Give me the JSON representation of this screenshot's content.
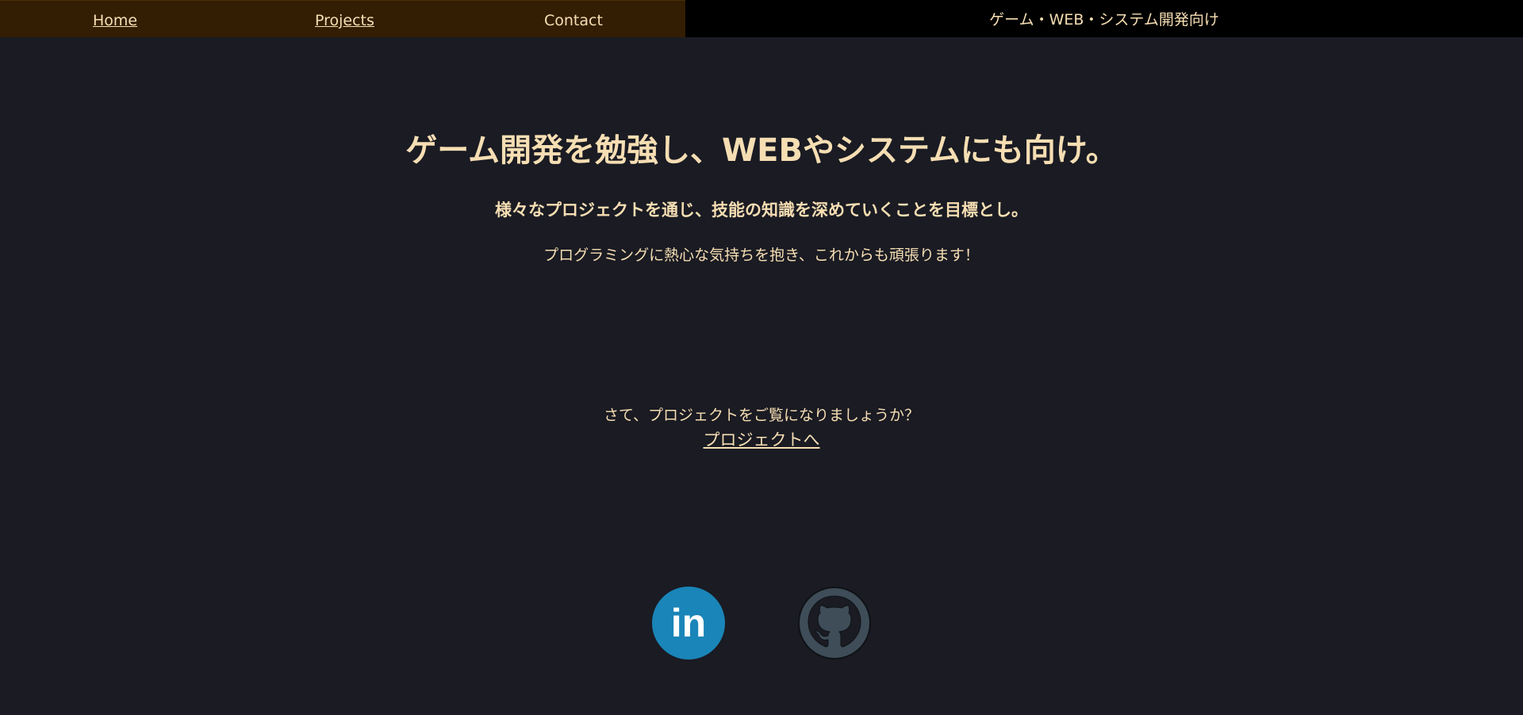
{
  "nav": {
    "home": "Home",
    "projects": "Projects",
    "contact": "Contact",
    "tagline": "ゲーム・WEB・システム開発向け"
  },
  "hero": {
    "heading": "ゲーム開発を勉強し、WEBやシステムにも向け。",
    "subheading": "様々なプロジェクトを通じ、技能の知識を深めていくことを目標とし。",
    "body": "プログラミングに熱心な気持ちを抱き、これからも頑張ります！"
  },
  "cta": {
    "question": "さて、プロジェクトをご覧になりましょうか？",
    "link": "プロジェクトへ"
  },
  "social": {
    "linkedin_icon": "linkedin-icon",
    "linkedin_text": "in",
    "github_icon": "github-icon"
  },
  "colors": {
    "background": "#1a1b23",
    "nav_bg": "#331e03",
    "tagline_bg": "#000000",
    "text": "#f6deb3",
    "linkedin": "#1a85b8",
    "github": "#3e4d58"
  }
}
